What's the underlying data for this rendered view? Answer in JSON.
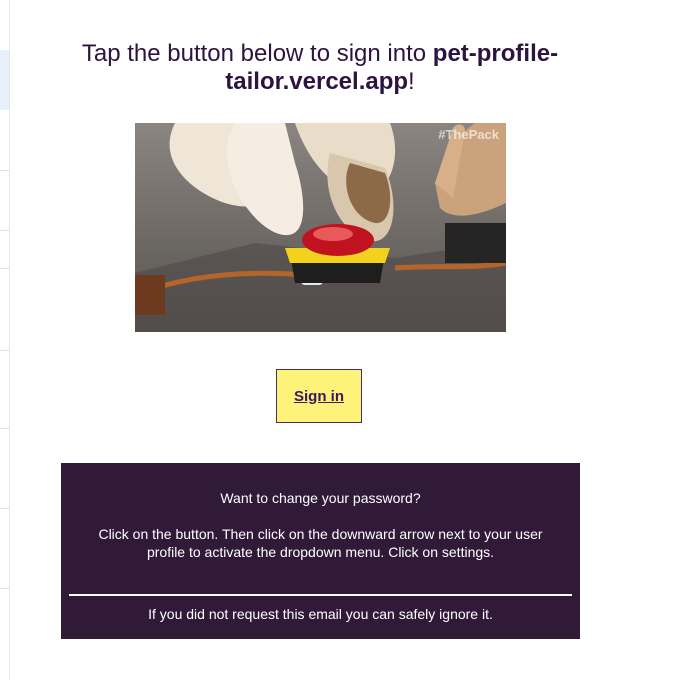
{
  "headline": {
    "prefix": "Tap the button below to sign into ",
    "site": "pet-profile-tailor.vercel.app",
    "suffix": "!"
  },
  "hero": {
    "watermark": "#ThePack",
    "icon": "dog-pressing-button-gif"
  },
  "signin": {
    "label": "Sign in"
  },
  "info": {
    "question": "Want to change your password?",
    "instructions": "Click on the button. Then click on the downward arrow next to your user profile to activate the dropdown menu. Click on settings.",
    "ignore": "If you did not request this email you can safely ignore it."
  },
  "colors": {
    "headline": "#2d1340",
    "button_bg": "#fdf27a",
    "button_text": "#3a1a5a",
    "info_bg": "#301a38"
  }
}
